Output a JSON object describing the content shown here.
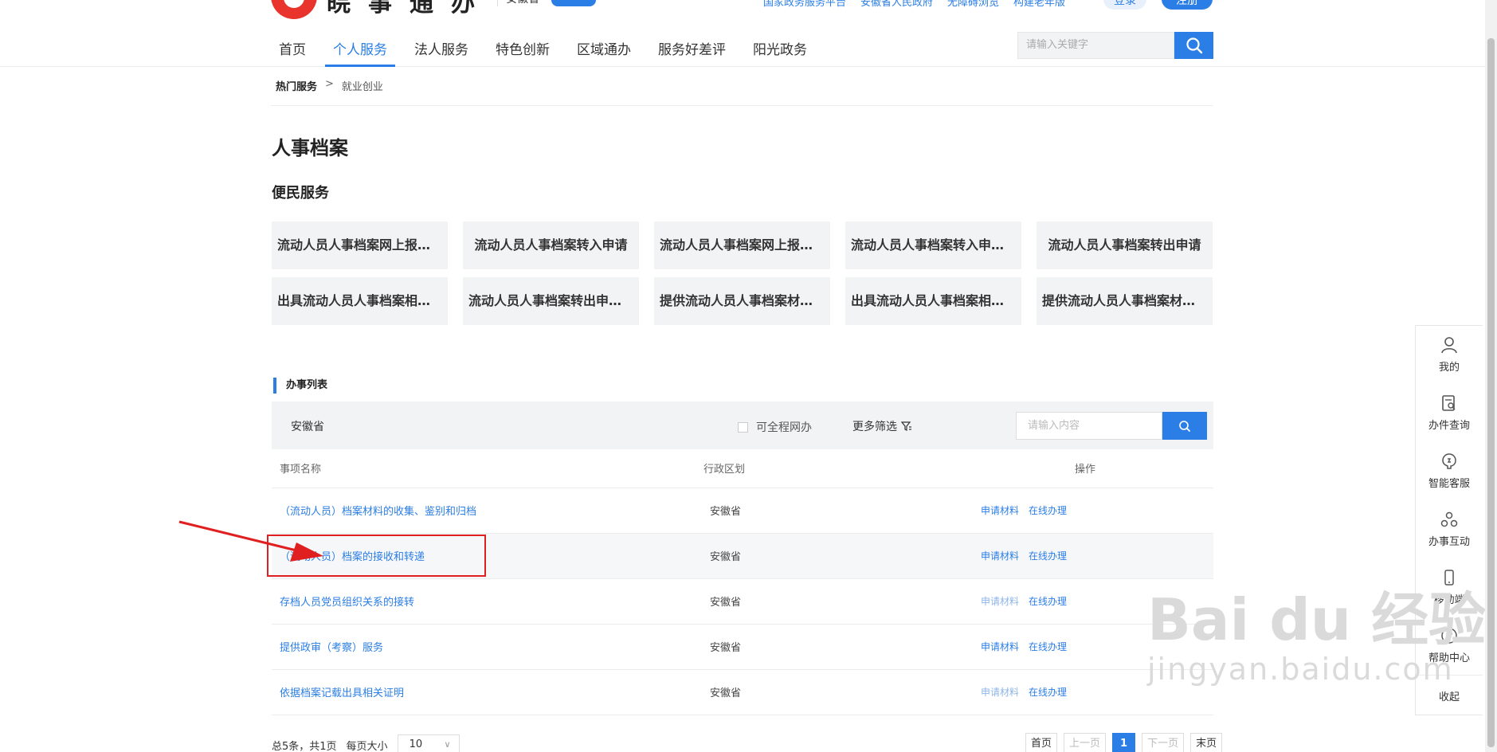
{
  "header": {
    "logo_text": "皖事通办",
    "region": "安徽省",
    "top_links": [
      "国家政务服务平台",
      "安徽省人民政府",
      "无障碍浏览",
      "构建老年版"
    ],
    "login_label": "登录",
    "register_label": "注册",
    "nav": [
      "首页",
      "个人服务",
      "法人服务",
      "特色创新",
      "区域通办",
      "服务好差评",
      "阳光政务"
    ],
    "nav_active_index": 1,
    "search_placeholder": "请输入关键字"
  },
  "breadcrumb": {
    "root": "热门服务",
    "separator": ">",
    "current": "就业创业"
  },
  "page_title": "人事档案",
  "convenience": {
    "title": "便民服务",
    "cards": [
      "流动人员人事档案网上报到...",
      "流动人员人事档案转入申请",
      "流动人员人事档案网上报到...",
      "流动人员人事档案转入申请...",
      "流动人员人事档案转出申请",
      "出具流动人员人事档案相关...",
      "流动人员人事档案转出申请...",
      "提供流动人员人事档案材料...",
      "出具流动人员人事档案相关...",
      "提供流动人员人事档案材料..."
    ]
  },
  "list": {
    "title": "办事列表",
    "filter_region": "安徽省",
    "filter_checkbox_label": "可全程网办",
    "more_filter_label": "更多筛选",
    "search_placeholder": "请输入内容",
    "columns": [
      "事项名称",
      "行政区划",
      "操作"
    ],
    "rows": [
      {
        "name": "（流动人员）档案材料的收集、鉴别和归档",
        "region": "安徽省",
        "op1": "申请材料",
        "op2": "在线办理"
      },
      {
        "name": "（流动人员）档案的接收和转递",
        "region": "安徽省",
        "op1": "申请材料",
        "op2": "在线办理"
      },
      {
        "name": "存档人员党员组织关系的接转",
        "region": "安徽省",
        "op1": "申请材料",
        "op2": "在线办理"
      },
      {
        "name": "提供政审（考察）服务",
        "region": "安徽省",
        "op1": "申请材料",
        "op2": "在线办理"
      },
      {
        "name": "依据档案记载出具相关证明",
        "region": "安徽省",
        "op1": "申请材料",
        "op2": "在线办理"
      }
    ]
  },
  "pagination": {
    "summary": "总5条，共1页",
    "page_size_label": "每页大小",
    "page_size": "10",
    "first": "首页",
    "prev": "上一页",
    "current": "1",
    "next": "下一页",
    "last": "末页"
  },
  "side_toolbar": {
    "items": [
      "我的",
      "办件查询",
      "智能客服",
      "办事互动",
      "移动端",
      "帮助中心"
    ],
    "collapse": "收起"
  },
  "watermark": {
    "brand": "Bai du 经验",
    "url": "jingyan.baidu.com"
  },
  "colors": {
    "accent": "#2b7ee5",
    "annotation": "#e02020",
    "logo_red": "#e8342c"
  }
}
